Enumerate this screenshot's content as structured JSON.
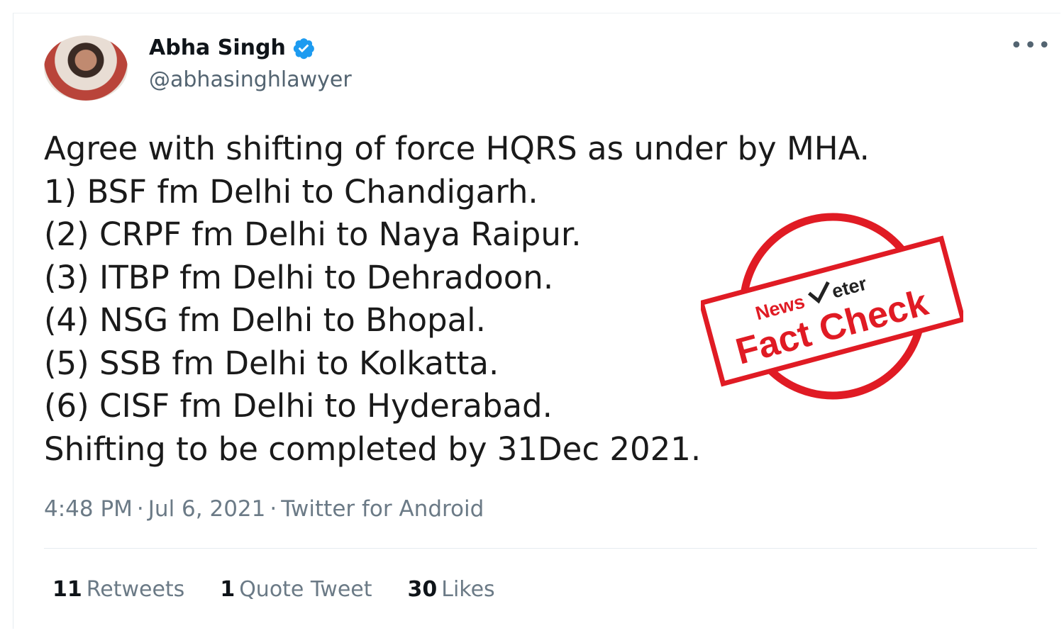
{
  "author": {
    "name": "Abha Singh",
    "handle": "@abhasinghlawyer"
  },
  "more_label": "•••",
  "tweet_lines": [
    "Agree with shifting of force HQRS as under by MHA.",
    "1) BSF fm Delhi to Chandigarh.",
    "(2) CRPF fm Delhi to Naya Raipur.",
    "(3) ITBP fm Delhi to Dehradoon.",
    "(4) NSG fm Delhi to Bhopal.",
    "(5) SSB fm Delhi to Kolkatta.",
    "(6) CISF fm Delhi to Hyderabad.",
    "Shifting to be completed by 31Dec 2021."
  ],
  "meta": {
    "time": "4:48 PM",
    "date": "Jul 6, 2021",
    "source": "Twitter for Android"
  },
  "stats": {
    "retweets_count": "11",
    "retweets_label": "Retweets",
    "quotes_count": "1",
    "quotes_label": "Quote Tweet",
    "likes_count": "30",
    "likes_label": "Likes"
  },
  "stamp": {
    "brand_left": "News",
    "brand_right": "eter",
    "title": "Fact Check"
  },
  "colors": {
    "verified": "#1d9bf0",
    "stamp_red": "#e01b24",
    "muted": "#536471"
  }
}
